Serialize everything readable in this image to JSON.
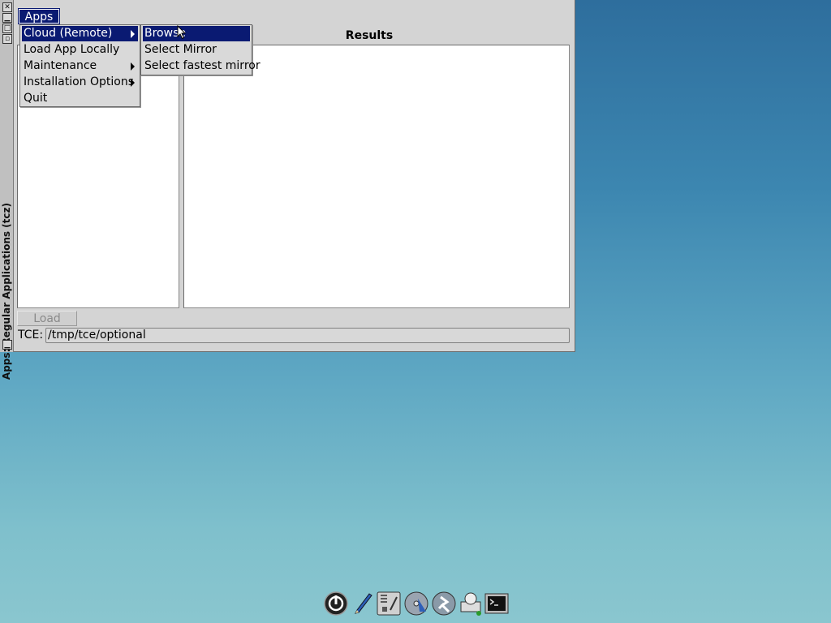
{
  "window": {
    "title": "Apps: Regular Applications (tcz)",
    "titlebar_buttons": [
      "close-icon",
      "minimize-icon",
      "maximize-icon",
      "restore-icon",
      "shade-icon"
    ]
  },
  "menubar": {
    "apps_label": "Apps"
  },
  "apps_menu": {
    "items": [
      {
        "label": "Cloud (Remote)",
        "submenu": true,
        "active": true
      },
      {
        "label": "Load App Locally",
        "submenu": false
      },
      {
        "label": "Maintenance",
        "submenu": true
      },
      {
        "label": "Installation Options",
        "submenu": true
      },
      {
        "label": "Quit",
        "submenu": false
      }
    ]
  },
  "cloud_submenu": {
    "items": [
      {
        "label": "Browse",
        "active": true
      },
      {
        "label": "Select Mirror"
      },
      {
        "label": "Select fastest mirror"
      }
    ]
  },
  "results": {
    "label": "Results"
  },
  "load_button": {
    "label": "Load",
    "enabled": false
  },
  "tce": {
    "label": "TCE:",
    "value": "/tmp/tce/optional"
  },
  "colors": {
    "highlight": "#0a1a72",
    "window_bg": "#d4d4d4"
  },
  "dock": {
    "icons": [
      "power-icon",
      "pen-icon",
      "control-panel-icon",
      "mount-icon",
      "apps-icon",
      "network-icon",
      "terminal-icon"
    ]
  }
}
